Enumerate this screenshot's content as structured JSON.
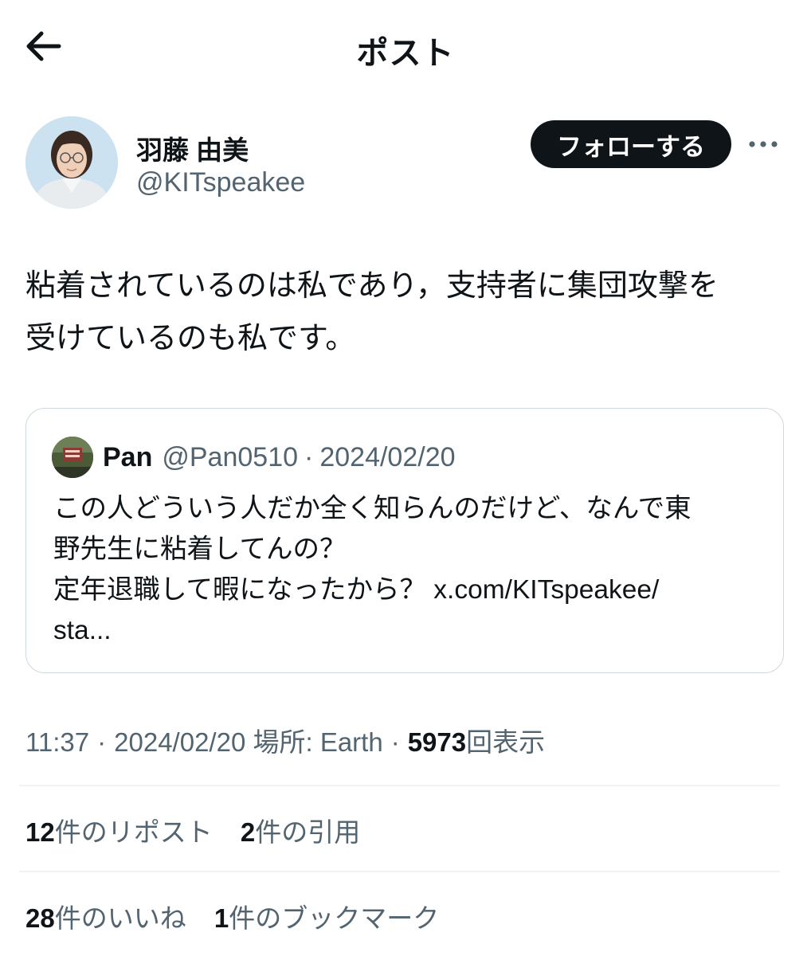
{
  "header": {
    "title": "ポスト"
  },
  "author": {
    "display_name": "羽藤 由美",
    "handle": "@KITspeakee",
    "follow_label": "フォローする"
  },
  "post": {
    "text": "粘着されているのは私であり，支持者に集団攻撃を\n受けているのも私です。"
  },
  "quote": {
    "name": "Pan",
    "handle": "@Pan0510",
    "separator": "·",
    "date": "2024/02/20",
    "text": "この人どういう人だか全く知らんのだけど、なんで東\n野先生に粘着してんの？\n定年退職して暇になったから？ x.com/KITspeakee/\nsta..."
  },
  "meta": {
    "time": "11:37",
    "separator": "·",
    "date": "2024/02/20",
    "location": "場所: Earth",
    "views_count": "5973",
    "views_label": "回表示"
  },
  "stats": {
    "reposts_count": "12",
    "reposts_label": "件のリポスト",
    "quotes_count": "2",
    "quotes_label": "件の引用",
    "likes_count": "28",
    "likes_label": "件のいいね",
    "bookmarks_count": "1",
    "bookmarks_label": "件のブックマーク"
  },
  "icons": {
    "back": "arrow-left-icon",
    "more": "more-horizontal-icon"
  },
  "colors": {
    "text_primary": "#0f1419",
    "text_secondary": "#536471",
    "border": "#cfd9de",
    "follow_button_bg": "#0f1419"
  }
}
